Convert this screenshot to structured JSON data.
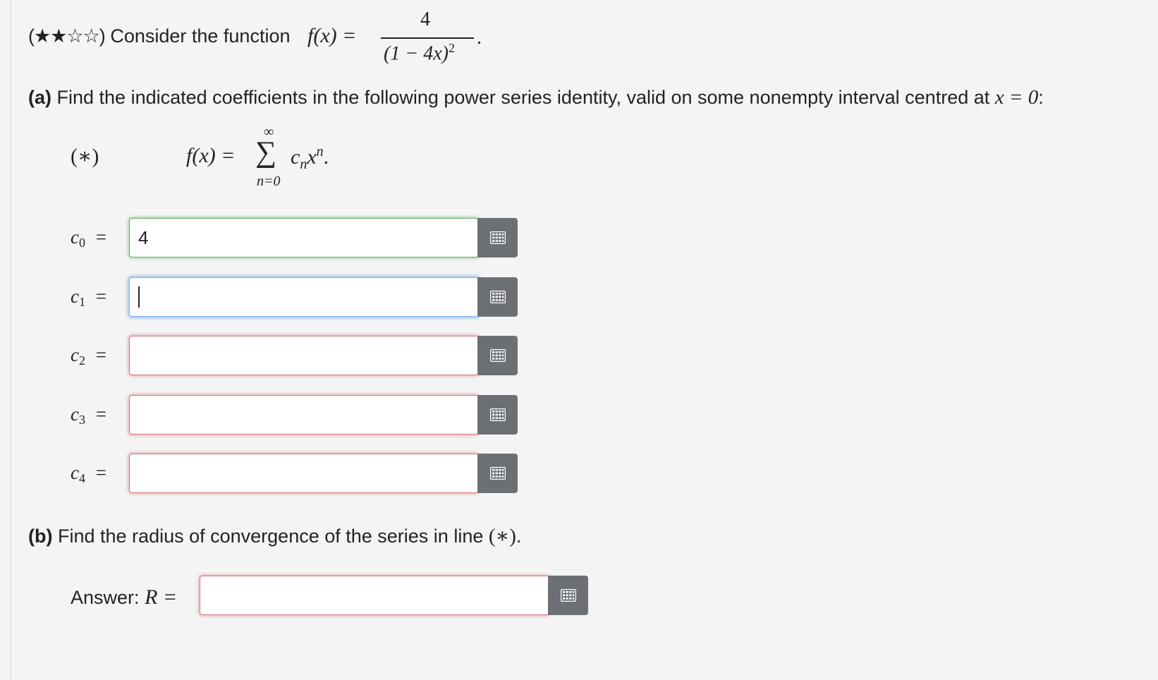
{
  "intro": {
    "stars": "(★★☆☆)",
    "text": "Consider the function",
    "lhs": "f(x) =",
    "numerator": "4",
    "denominator": "(1 − 4x)",
    "den_exp": "2",
    "period": "."
  },
  "part_a": {
    "label": "(a)",
    "text": "Find the indicated coefficients in the following power series identity, valid on some nonempty interval centred at",
    "cond": "x = 0",
    "colon": ":"
  },
  "identity": {
    "tag": "(∗)",
    "lhs": "f(x) =",
    "sum_top": "∞",
    "sum": "∑",
    "sum_bottom": "n=0",
    "term": "c",
    "term_sub": "n",
    "term_x": "x",
    "term_exp": "n",
    "period": "."
  },
  "coefficients": [
    {
      "label": "c",
      "sub": "0",
      "eq": "=",
      "value": "4",
      "state": "correct"
    },
    {
      "label": "c",
      "sub": "1",
      "eq": "=",
      "value": "",
      "state": "focused"
    },
    {
      "label": "c",
      "sub": "2",
      "eq": "=",
      "value": "",
      "state": "incorrect"
    },
    {
      "label": "c",
      "sub": "3",
      "eq": "=",
      "value": "",
      "state": "incorrect"
    },
    {
      "label": "c",
      "sub": "4",
      "eq": "=",
      "value": "",
      "state": "incorrect"
    }
  ],
  "part_b": {
    "label": "(b)",
    "text": "Find the radius of convergence of the series in line",
    "ref": "(∗)",
    "period": "."
  },
  "answer": {
    "label": "Answer:",
    "var": "R =",
    "value": "",
    "state": "incorrect"
  },
  "palette_icon": "grid-icon",
  "colors": {
    "background": "#f4f4f4",
    "correct_border": "#63b261",
    "focus_border": "#7fb3e8",
    "incorrect_border": "#d27a7a",
    "palette_button": "#6c7075"
  }
}
